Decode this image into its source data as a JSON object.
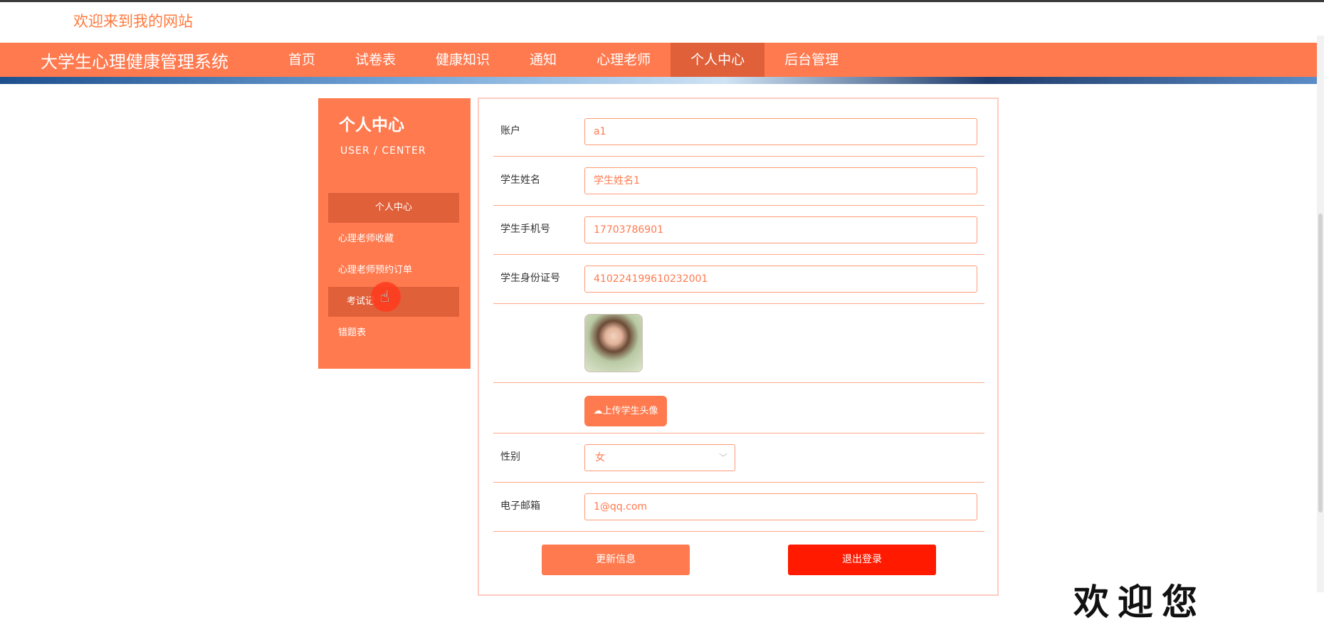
{
  "header": {
    "welcome": "欢迎来到我的网站"
  },
  "nav": {
    "brand": "大学生心理健康管理系统",
    "items": [
      {
        "label": "首页"
      },
      {
        "label": "试卷表"
      },
      {
        "label": "健康知识"
      },
      {
        "label": "通知"
      },
      {
        "label": "心理老师"
      },
      {
        "label": "个人中心"
      },
      {
        "label": "后台管理"
      }
    ],
    "active": "个人中心"
  },
  "sidebar": {
    "title": "个人中心",
    "subtitle": "USER / CENTER",
    "items": [
      {
        "label": "个人中心"
      },
      {
        "label": "心理老师收藏"
      },
      {
        "label": "心理老师预约订单"
      },
      {
        "label": "考试记"
      },
      {
        "label": "错题表"
      }
    ]
  },
  "form": {
    "account_label": "账户",
    "account_value": "a1",
    "name_label": "学生姓名",
    "name_value": "学生姓名1",
    "phone_label": "学生手机号",
    "phone_value": "17703786901",
    "id_label": "学生身份证号",
    "id_value": "410224199610232001",
    "upload_label": "上传学生头像",
    "gender_label": "性别",
    "gender_value": "女",
    "email_label": "电子邮箱",
    "email_value": "1@qq.com",
    "update_label": "更新信息",
    "logout_label": "退出登录"
  },
  "footer_fragment": "欢迎您"
}
